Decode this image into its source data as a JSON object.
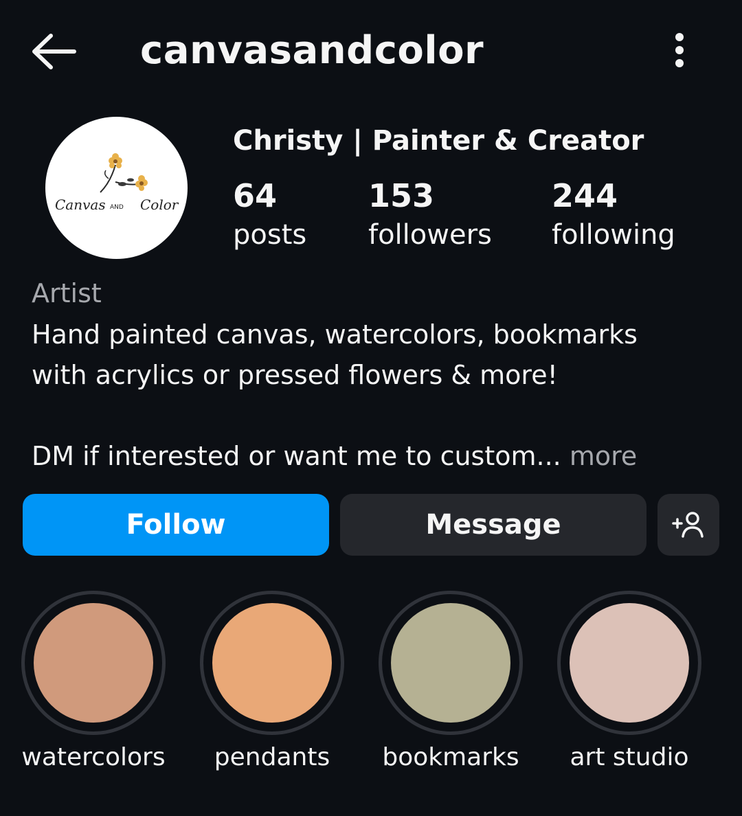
{
  "header": {
    "username": "canvasandcolor"
  },
  "profile": {
    "display_name": "Christy | Painter & Creator",
    "logo_text": {
      "left": "Canvas",
      "middle": "AND",
      "right": "Color"
    },
    "stats": [
      {
        "value": "64",
        "label": "posts"
      },
      {
        "value": "153",
        "label": "followers"
      },
      {
        "value": "244",
        "label": "following"
      }
    ],
    "category": "Artist",
    "bio": {
      "line1": "Hand painted canvas, watercolors, bookmarks",
      "line2": "with acrylics or pressed flowers & more!",
      "line3": "DM if interested or want me to custom...",
      "more": "more"
    }
  },
  "actions": {
    "follow": "Follow",
    "message": "Message"
  },
  "highlights": [
    {
      "label": "watercolors",
      "color": "#d09a7c"
    },
    {
      "label": "pendants",
      "color": "#e9a877"
    },
    {
      "label": "bookmarks",
      "color": "#b5b193"
    },
    {
      "label": "art studio",
      "color": "#dcc1b7"
    }
  ],
  "colors": {
    "background": "#0c0f14",
    "accent": "#0095f6",
    "secondary_button": "#25272c",
    "muted_text": "#a6a8ad"
  }
}
